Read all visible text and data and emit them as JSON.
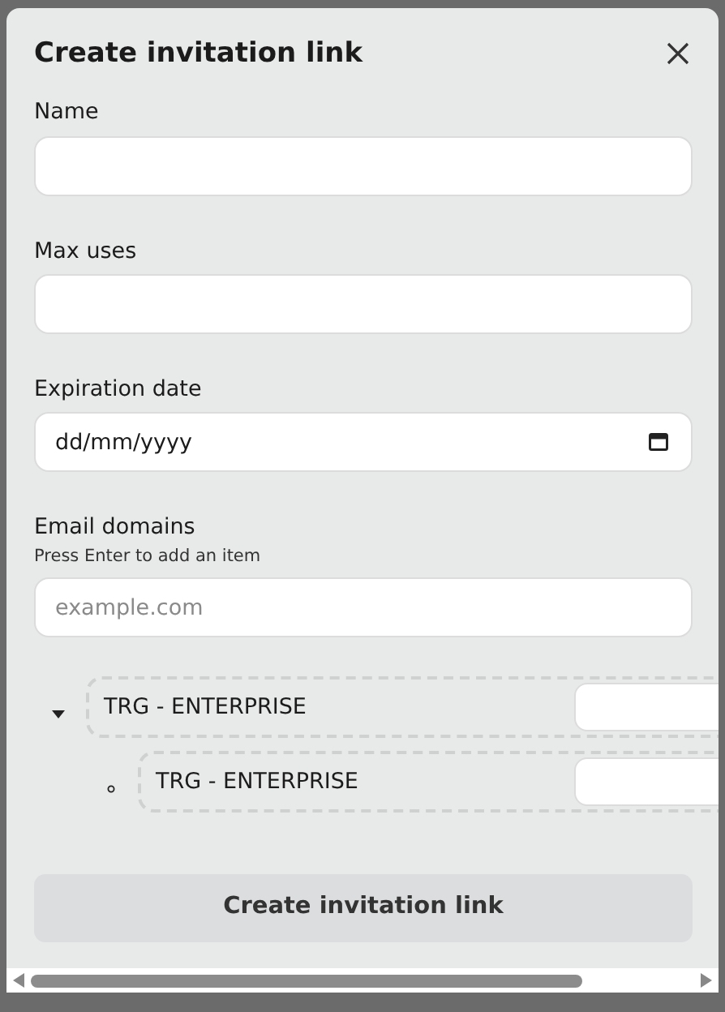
{
  "dialog": {
    "title": "Create invitation link"
  },
  "fields": [
    {
      "kind": "text",
      "label": "Name"
    },
    {
      "kind": "text",
      "label": "Max uses"
    },
    {
      "kind": "date",
      "label": "Expiration date",
      "placeholder": "dd/mm/yyyy"
    },
    {
      "kind": "text",
      "label": "Email domains",
      "hint": "Press Enter to add an item",
      "placeholder": "example.com"
    }
  ],
  "tree": [
    {
      "label": "TRG - ENTERPRISE",
      "expanded": true,
      "children": [
        {
          "label": "TRG - ENTERPRISE"
        }
      ]
    }
  ],
  "submit_button": "Create invitation link"
}
